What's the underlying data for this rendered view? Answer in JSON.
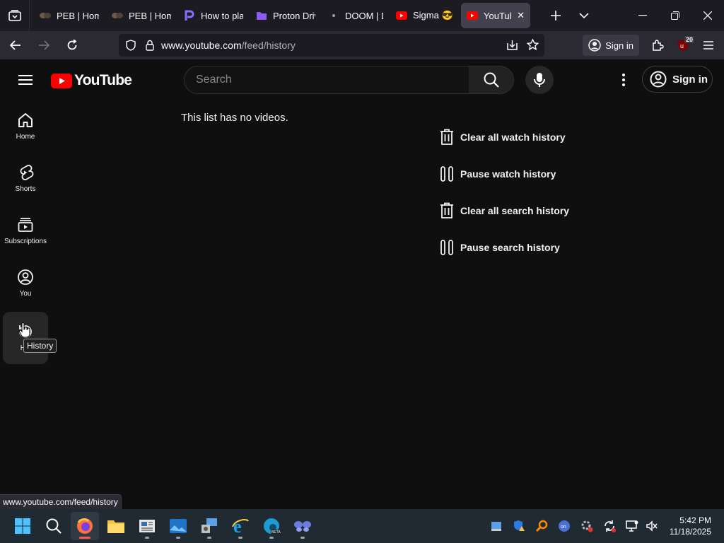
{
  "browser": {
    "tabs": [
      {
        "label": "PEB | Home",
        "icon": "peb-icon",
        "active": false
      },
      {
        "label": "PEB | Home",
        "icon": "peb-icon",
        "active": false
      },
      {
        "label": "How to pla",
        "icon": "p-logo-icon",
        "active": false
      },
      {
        "label": "Proton Driv",
        "icon": "proton-drive-icon",
        "active": false
      },
      {
        "label": "DOOM | D(",
        "icon": "dot-icon",
        "active": false
      },
      {
        "label": "Sigma 😎 #s",
        "icon": "youtube-icon",
        "active": false
      },
      {
        "label": "YouTube",
        "icon": "youtube-icon",
        "active": true
      }
    ],
    "url_domain": "www.youtube.com",
    "url_path": "/feed/history",
    "signin_label": "Sign in",
    "extension_badge": "20"
  },
  "youtube": {
    "logo_text": "YouTube",
    "search_placeholder": "Search",
    "signin_label": "Sign in",
    "guide": [
      {
        "label": "Home",
        "icon": "home-icon"
      },
      {
        "label": "Shorts",
        "icon": "shorts-icon"
      },
      {
        "label": "Subscriptions",
        "icon": "subscriptions-icon"
      },
      {
        "label": "You",
        "icon": "you-icon"
      },
      {
        "label": "His",
        "icon": "history-icon"
      }
    ],
    "empty_message": "This list has no videos.",
    "actions": [
      {
        "label": "Clear all watch history",
        "icon": "trash-icon"
      },
      {
        "label": "Pause watch history",
        "icon": "pause-icon"
      },
      {
        "label": "Clear all search history",
        "icon": "trash-icon"
      },
      {
        "label": "Pause search history",
        "icon": "pause-icon"
      }
    ],
    "tooltip": "History",
    "status_url": "www.youtube.com/feed/history"
  },
  "taskbar": {
    "time": "5:42 PM",
    "date": "11/18/2025"
  },
  "colors": {
    "youtube_red": "#ff0000",
    "page_bg": "#0f0f0f",
    "firefox_tab_active": "#42414d"
  }
}
